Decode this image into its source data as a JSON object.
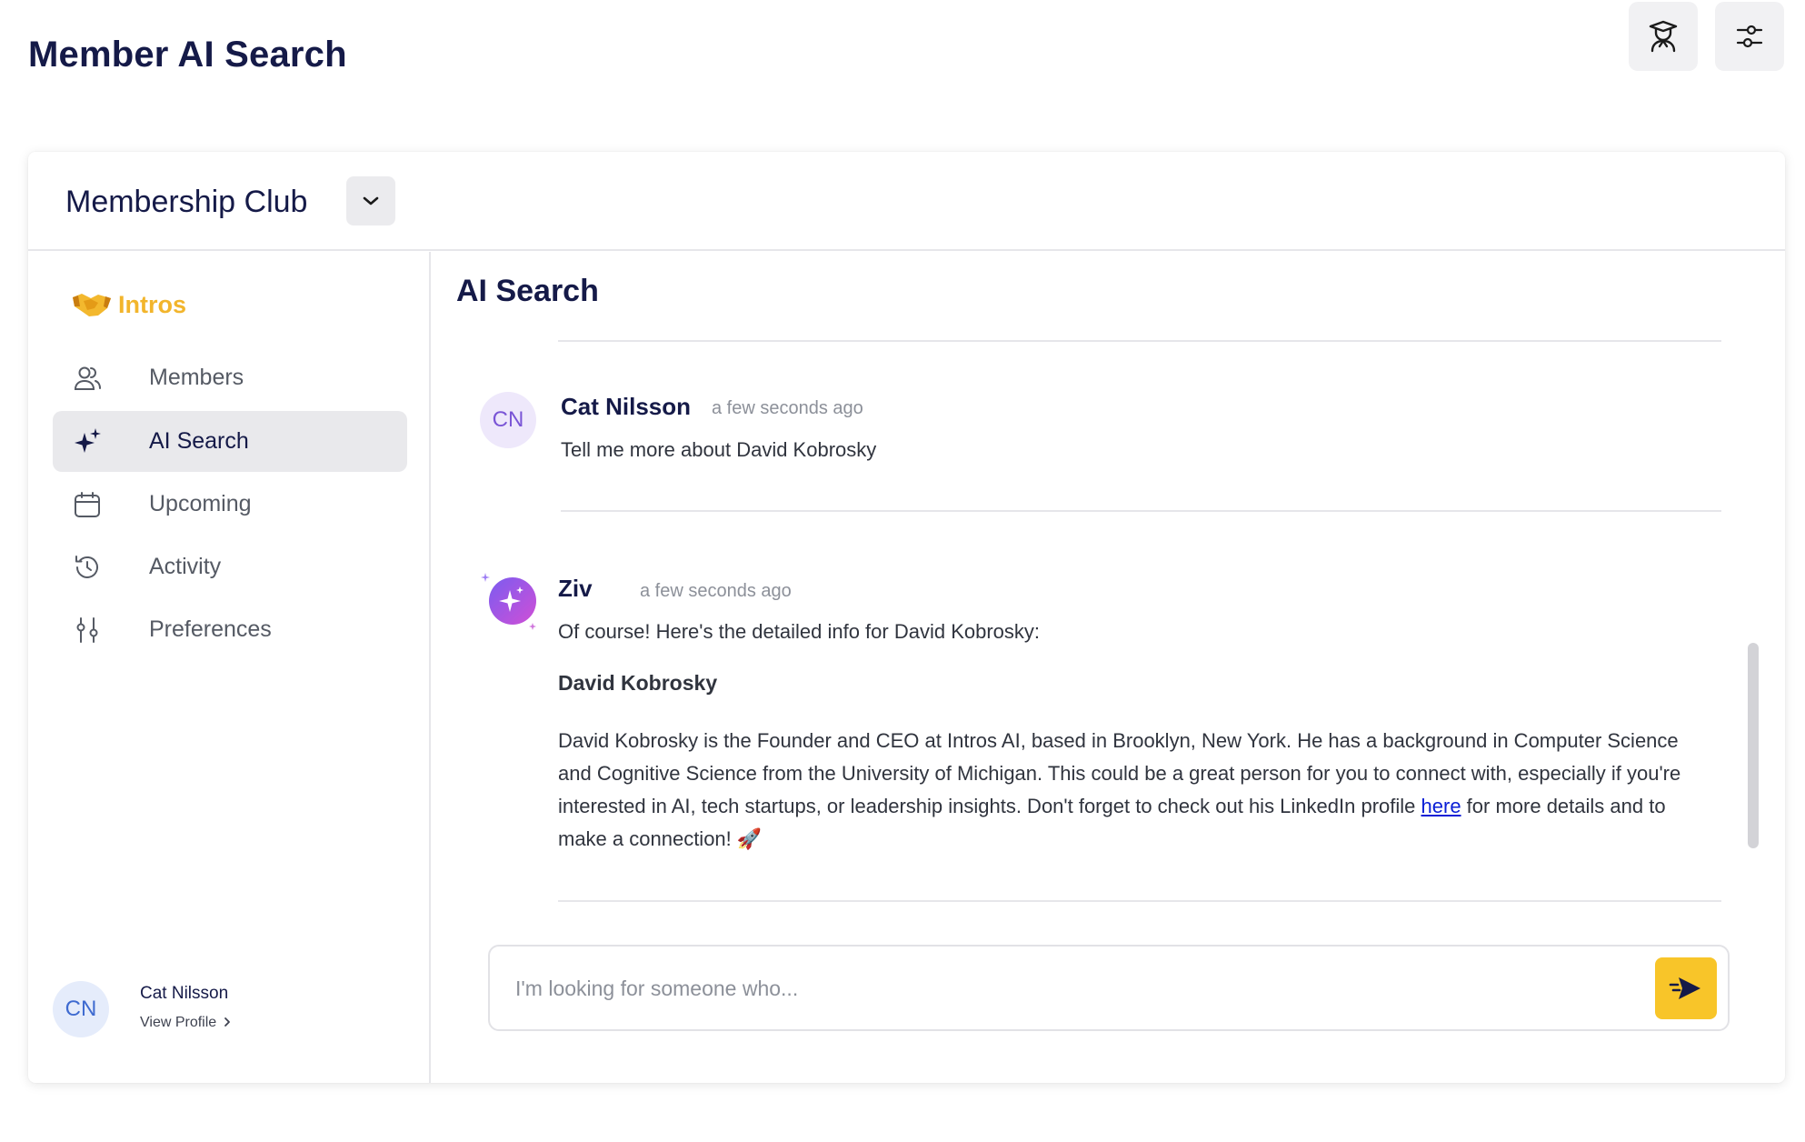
{
  "page": {
    "title": "Member AI Search"
  },
  "toolbar": {
    "tutor_icon": "graduation-cap-user-icon",
    "settings_icon": "sliders-icon"
  },
  "club": {
    "name": "Membership Club"
  },
  "sidebar": {
    "brand": "Intros",
    "items": [
      {
        "label": "Members",
        "icon": "users-icon"
      },
      {
        "label": "AI Search",
        "icon": "sparkles-icon",
        "active": true
      },
      {
        "label": "Upcoming",
        "icon": "calendar-icon"
      },
      {
        "label": "Activity",
        "icon": "history-icon"
      },
      {
        "label": "Preferences",
        "icon": "sliders-vertical-icon"
      }
    ],
    "profile": {
      "initials": "CN",
      "name": "Cat Nilsson",
      "link": "View Profile"
    }
  },
  "main": {
    "title": "AI Search",
    "messages": [
      {
        "initials": "CN",
        "author": "Cat Nilsson",
        "time": "a few seconds ago",
        "text": "Tell me more about David Kobrosky"
      },
      {
        "author": "Ziv",
        "time": "a few seconds ago",
        "intro": "Of course! Here's the detailed info for David Kobrosky:",
        "heading": "David Kobrosky",
        "body": "David Kobrosky is the Founder and CEO at Intros AI, based in Brooklyn, New York. He has a background in Computer Science and Cognitive Science from the University of Michigan. This could be a great person for you to connect with, especially if you're interested in AI, tech startups, or leadership insights. Don't forget to check out his LinkedIn profile",
        "link_text": "here",
        "tail": " for more details and to make a connection! 🚀"
      }
    ],
    "composer": {
      "placeholder": "I'm looking for someone who..."
    }
  },
  "colors": {
    "accent": "#f8c529",
    "brand": "#f2b52c",
    "title": "#151a48",
    "ai_gradient": [
      "#7b5cf0",
      "#d04fd6"
    ]
  }
}
